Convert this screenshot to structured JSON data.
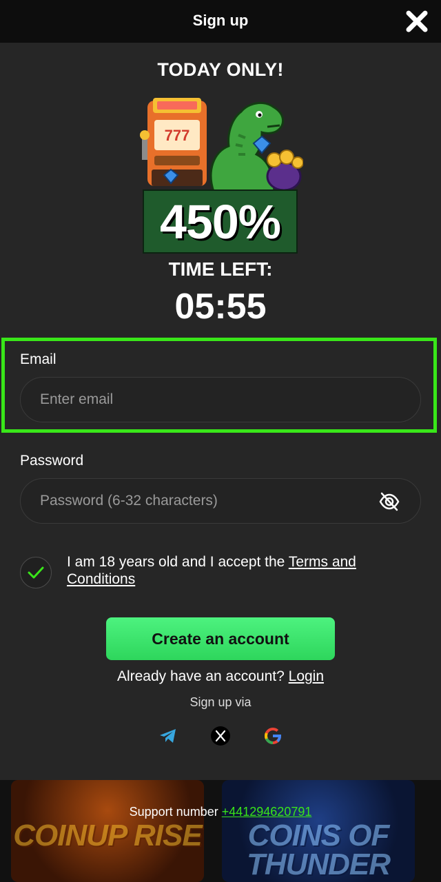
{
  "header": {
    "title": "Sign up",
    "close_icon": "close-x-icon"
  },
  "promo": {
    "title": "TODAY ONLY!",
    "bonus": "450%",
    "time_left_label": "TIME LEFT:",
    "timer": "05:55"
  },
  "form": {
    "email": {
      "label": "Email",
      "placeholder": "Enter email"
    },
    "password": {
      "label": "Password",
      "placeholder": "Password (6-32 characters)",
      "toggle_icon": "eye-off-icon"
    },
    "terms": {
      "text": "I am 18 years old and I accept the ",
      "link": "Terms and Conditions",
      "checked": true
    },
    "submit_label": "Create an account",
    "have_account": "Already have an account?",
    "login_link": "Login",
    "sign_up_via": "Sign up via",
    "social": [
      "telegram-icon",
      "x-icon",
      "google-icon"
    ]
  },
  "footer": {
    "support_label": "Support number",
    "support_number": "+441294620791",
    "games": [
      "COINUP RISE",
      "COINS OF THUNDER"
    ]
  },
  "colors": {
    "highlight": "#39e619",
    "cta": "#3ee46e",
    "background": "#262626",
    "topbar": "#0d0d0d"
  }
}
